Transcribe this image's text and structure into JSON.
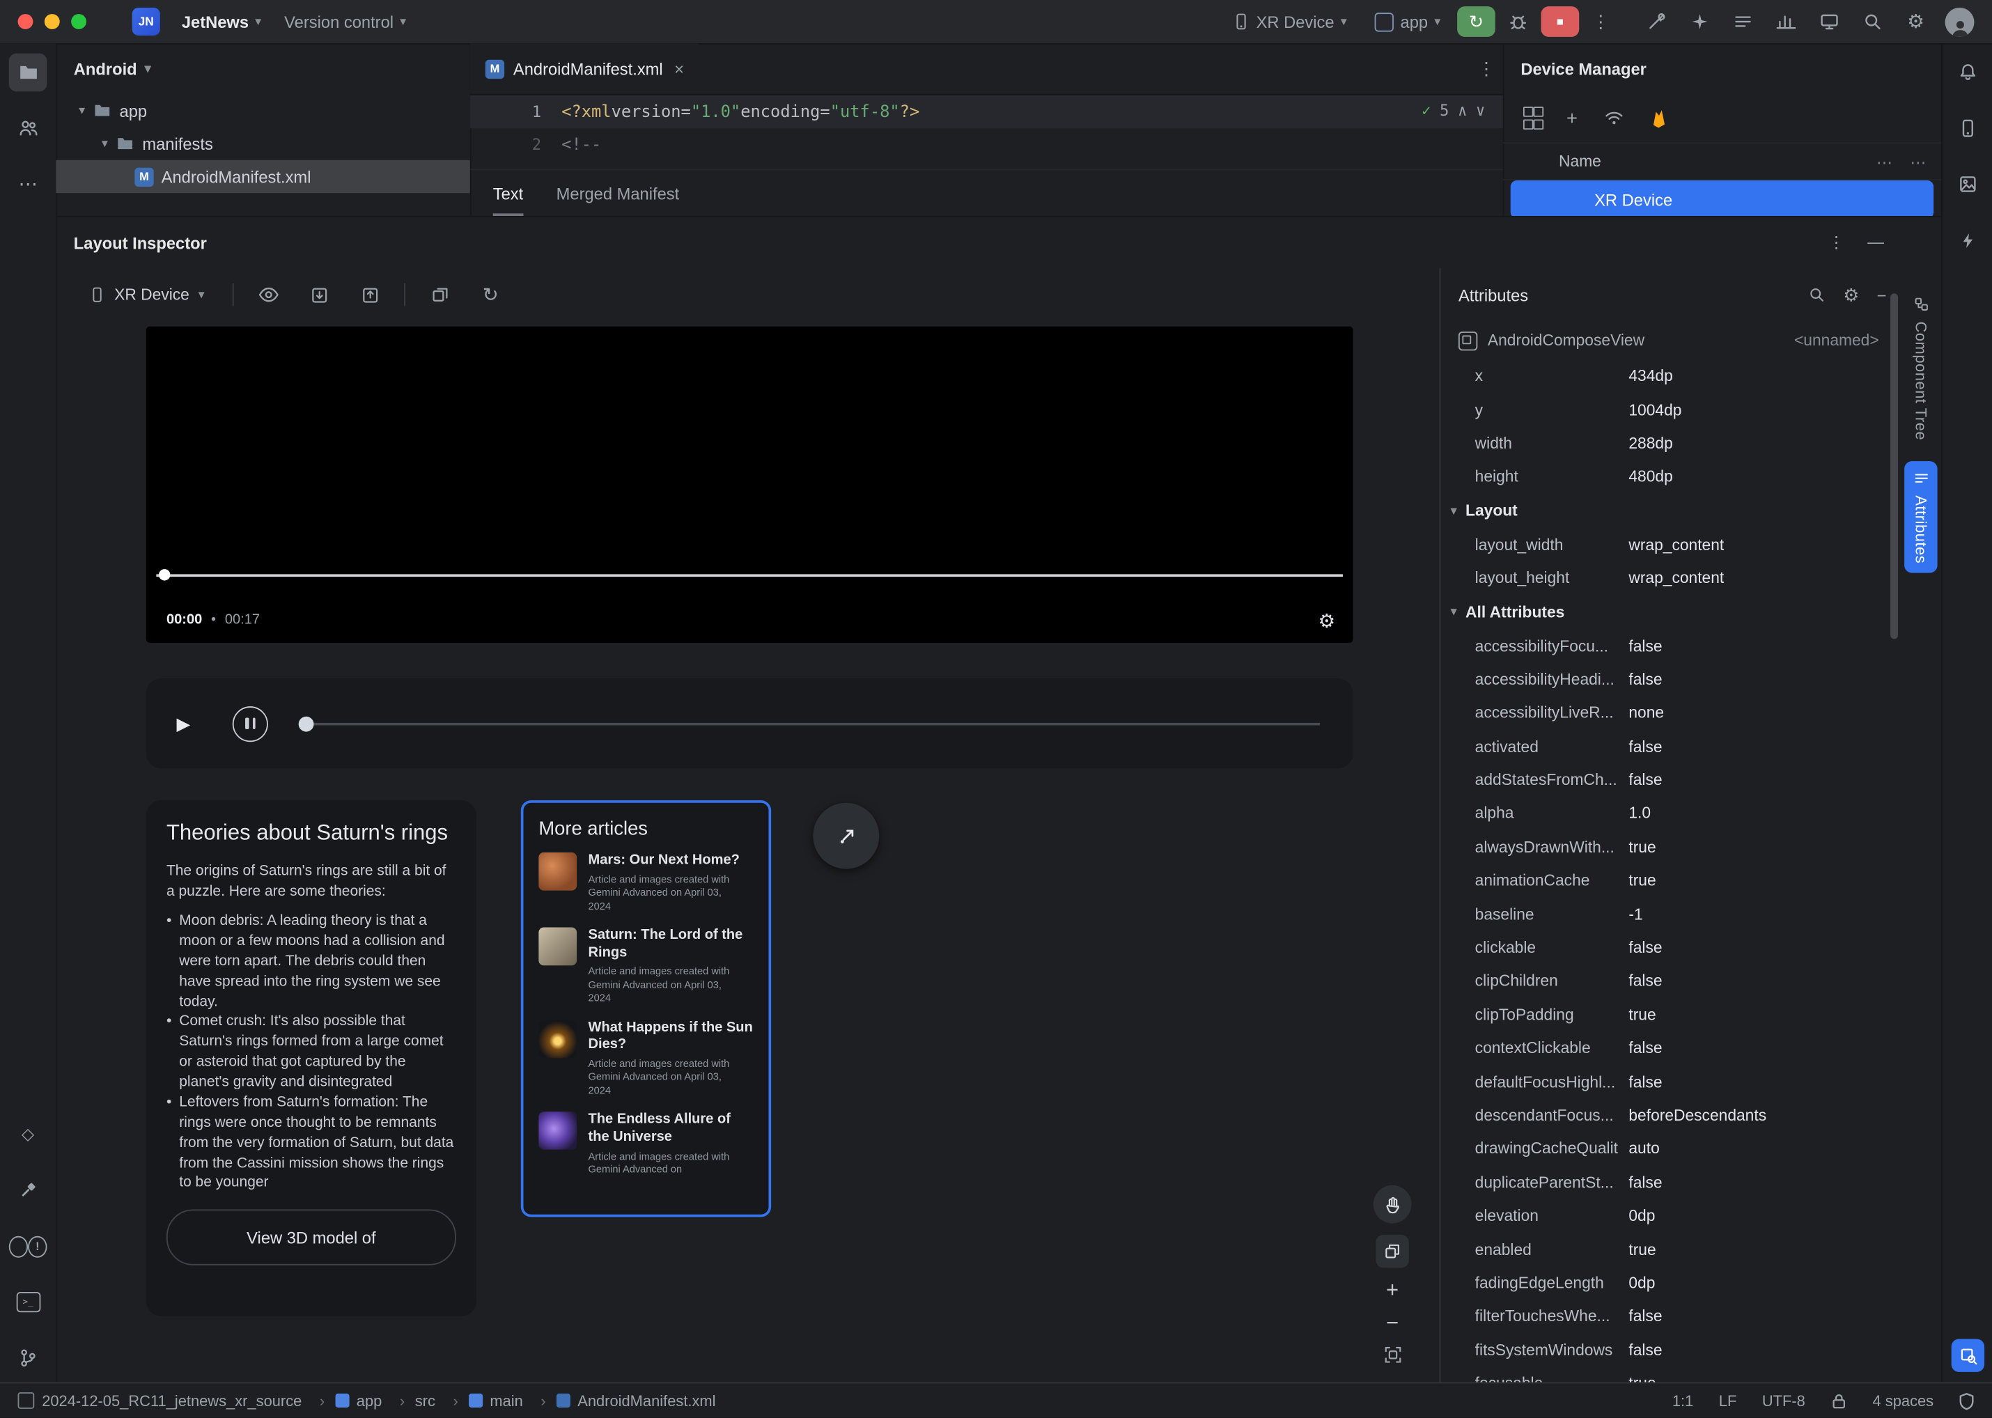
{
  "colors": {
    "accent_blue": "#3574F0",
    "selection_blue": "#2E436E",
    "run_green": "#57965C",
    "stop_red": "#DB5C5C",
    "string_green": "#6AAB73",
    "tag_yellow": "#D5B778",
    "firebase_orange": "#FFA611",
    "mac_close": "#FF5F57",
    "mac_minimize": "#FEBC2E",
    "mac_zoom": "#28C840"
  },
  "icons": {
    "chevron": "▾",
    "more_v": "⋮",
    "more_h": "⋯",
    "close": "×",
    "check": "✓",
    "plus": "+",
    "minus": "−",
    "refresh": "↻",
    "rerun": "↻",
    "gear": "⚙",
    "caret_up": "∧",
    "caret_down": "∨",
    "play": "▶",
    "stop": "■",
    "dot": "•",
    "bullet": "•",
    "diamond": "◇",
    "bang": "!",
    "prompt": ">_",
    "dash": "—"
  },
  "titlebar": {
    "project_badge": "JN",
    "project": "JetNews",
    "version_control": "Version control",
    "device": "XR Device",
    "run_config": "app"
  },
  "project_panel": {
    "title": "Android",
    "rows": [
      {
        "label": "app"
      },
      {
        "label": "manifests"
      },
      {
        "label": "AndroidManifest.xml"
      }
    ]
  },
  "editor": {
    "tab": "AndroidManifest.xml",
    "line1_num": "1",
    "line2_num": "2",
    "inspections": "5",
    "code": {
      "pi_open": "<?xml ",
      "attr1": "version=",
      "str1": "\"1.0\"",
      "attr2": " encoding=",
      "str2": "\"utf-8\"",
      "pi_close": "?>",
      "comment": "<!--"
    },
    "tabs": {
      "text": "Text",
      "merged": "Merged Manifest"
    }
  },
  "device_manager": {
    "title": "Device Manager",
    "name_col": "Name",
    "device": "XR Device"
  },
  "inspector": {
    "title": "Layout Inspector",
    "device": "XR Device"
  },
  "preview": {
    "video": {
      "current": "00:00",
      "total": "00:17"
    },
    "saturn_card": {
      "title": "Theories about Saturn's rings",
      "intro": "The origins of Saturn's rings are still a bit of a puzzle. Here are some theories:",
      "bullets": [
        "Moon debris: A leading theory is that a moon or a few moons had a collision and were torn apart. The debris could then have spread into the ring system we see today.",
        "Comet crush: It's also possible that Saturn's rings formed from a large comet or asteroid that got captured by the planet's gravity and disintegrated",
        "Leftovers from Saturn's formation: The rings were once thought to be remnants from the very formation of Saturn, but data from the Cassini mission shows the rings to be younger"
      ],
      "button": "View 3D model of"
    },
    "more": {
      "title": "More articles",
      "items": [
        {
          "title": "Mars: Our Next Home?",
          "caption": "Article and images created with Gemini Advanced on April 03, 2024",
          "thumb": "mars"
        },
        {
          "title": "Saturn: The Lord of the Rings",
          "caption": "Article and images created with Gemini Advanced on April 03, 2024",
          "thumb": "saturn"
        },
        {
          "title": "What Happens if the Sun Dies?",
          "caption": "Article and images created with Gemini Advanced on April 03, 2024",
          "thumb": "sun"
        },
        {
          "title": "The Endless Allure of the Universe",
          "caption": "Article and images created with Gemini Advanced on",
          "thumb": "galaxy"
        }
      ]
    }
  },
  "attributes": {
    "title": "Attributes",
    "component": "AndroidComposeView",
    "unnamed": "<unnamed>",
    "top": [
      {
        "n": "x",
        "v": "434dp"
      },
      {
        "n": "y",
        "v": "1004dp"
      },
      {
        "n": "width",
        "v": "288dp"
      },
      {
        "n": "height",
        "v": "480dp"
      }
    ],
    "layout_header": "Layout",
    "layout_rows": [
      {
        "n": "layout_width",
        "v": "wrap_content"
      },
      {
        "n": "layout_height",
        "v": "wrap_content"
      }
    ],
    "all_header": "All Attributes",
    "rows": [
      {
        "n": "accessibilityFocu...",
        "v": "false"
      },
      {
        "n": "accessibilityHeadi...",
        "v": "false"
      },
      {
        "n": "accessibilityLiveR...",
        "v": "none"
      },
      {
        "n": "activated",
        "v": "false"
      },
      {
        "n": "addStatesFromCh...",
        "v": "false"
      },
      {
        "n": "alpha",
        "v": "1.0"
      },
      {
        "n": "alwaysDrawnWith...",
        "v": "true"
      },
      {
        "n": "animationCache",
        "v": "true"
      },
      {
        "n": "baseline",
        "v": "-1"
      },
      {
        "n": "clickable",
        "v": "false"
      },
      {
        "n": "clipChildren",
        "v": "false"
      },
      {
        "n": "clipToPadding",
        "v": "true"
      },
      {
        "n": "contextClickable",
        "v": "false"
      },
      {
        "n": "defaultFocusHighl...",
        "v": "false"
      },
      {
        "n": "descendantFocus...",
        "v": "beforeDescendants"
      },
      {
        "n": "drawingCacheQualit",
        "v": "auto"
      },
      {
        "n": "duplicateParentSt...",
        "v": "false"
      },
      {
        "n": "elevation",
        "v": "0dp"
      },
      {
        "n": "enabled",
        "v": "true"
      },
      {
        "n": "fadingEdgeLength",
        "v": "0dp"
      },
      {
        "n": "filterTouchesWhe...",
        "v": "false"
      },
      {
        "n": "fitsSystemWindows",
        "v": "false"
      },
      {
        "n": "focusable",
        "v": "true"
      }
    ]
  },
  "vertical_tabs": {
    "component_tree": "Component Tree",
    "attributes": "Attributes"
  },
  "statusbar": {
    "crumbs": [
      {
        "label": "2024-12-05_RC11_jetnews_xr_source",
        "icon": "c-mod",
        "sep": "›"
      },
      {
        "label": "app",
        "icon": "c-blue",
        "sep": "›"
      },
      {
        "label": "src",
        "icon": "c-none",
        "sep": "›"
      },
      {
        "label": "main",
        "icon": "c-blue",
        "sep": "›"
      },
      {
        "label": "AndroidManifest.xml",
        "icon": "c-man",
        "sep": ""
      }
    ],
    "caret": "1:1",
    "line_sep": "LF",
    "encoding": "UTF-8",
    "indent": "4 spaces"
  }
}
